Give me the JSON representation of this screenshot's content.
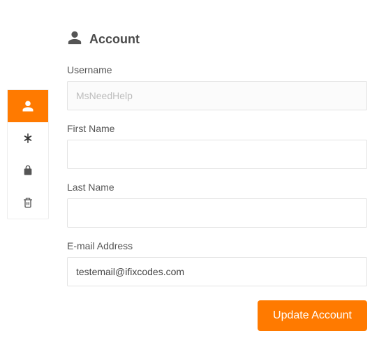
{
  "page": {
    "title": "Account"
  },
  "sidebar": {
    "items": [
      {
        "icon": "user",
        "active": true
      },
      {
        "icon": "asterisk",
        "active": false
      },
      {
        "icon": "lock",
        "active": false
      },
      {
        "icon": "trash",
        "active": false
      }
    ]
  },
  "form": {
    "username": {
      "label": "Username",
      "value": "MsNeedHelp"
    },
    "first_name": {
      "label": "First Name",
      "value": ""
    },
    "last_name": {
      "label": "Last Name",
      "value": ""
    },
    "email": {
      "label": "E-mail Address",
      "value": "testemail@ifixcodes.com"
    }
  },
  "actions": {
    "submit": "Update Account"
  },
  "colors": {
    "accent": "#ff7a00"
  }
}
